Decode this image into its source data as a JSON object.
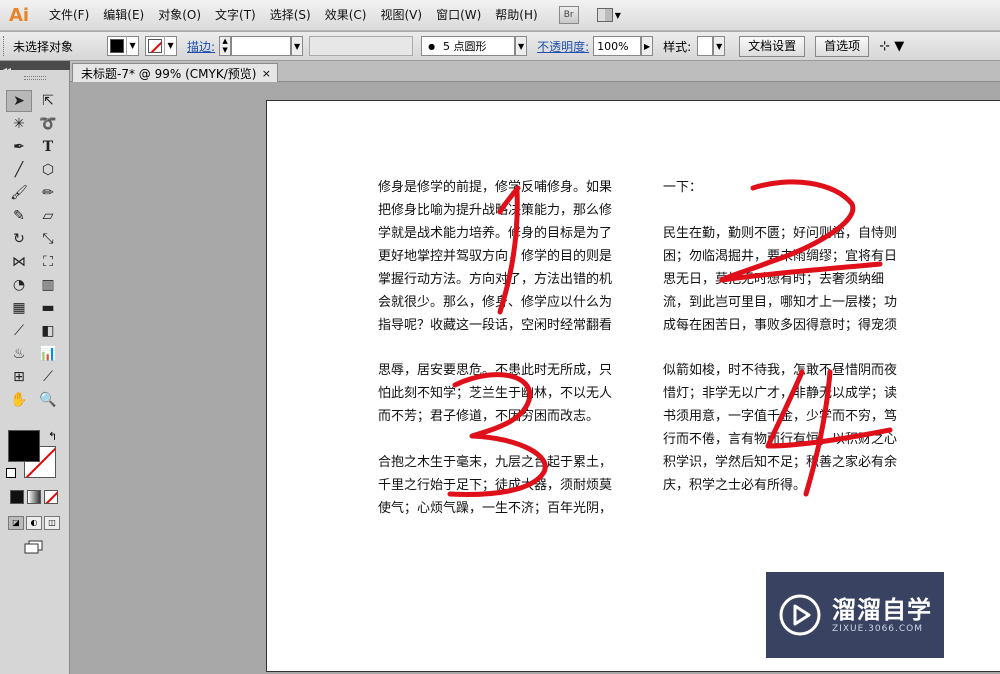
{
  "app": {
    "logo": "Ai",
    "menus": [
      "文件(F)",
      "编辑(E)",
      "对象(O)",
      "文字(T)",
      "选择(S)",
      "效果(C)",
      "视图(V)",
      "窗口(W)",
      "帮助(H)"
    ],
    "bridge_label": "Br"
  },
  "control_bar": {
    "selection_status": "未选择对象",
    "stroke_label": "描边:",
    "brush_value": "5 点圆形",
    "opacity_label": "不透明度:",
    "opacity_value": "100%",
    "style_label": "样式:",
    "doc_setup_button": "文档设置",
    "preferences_button": "首选项"
  },
  "document": {
    "tab_title": "未标题-7* @ 99% (CMYK/预览)",
    "close_glyph": "×"
  },
  "columns": {
    "col1": "修身是修学的前提，修学反哺修身。如果\n把修身比喻为提升战略决策能力，那么修\n学就是战术能力培养。修身的目标是为了\n更好地掌控并驾驭方向，修学的目的则是\n掌握行动方法。方向对了，方法出错的机\n会就很少。那么，修身、修学应以什么为\n指导呢？收藏这一段话，空闲时经常翻看",
    "col2": "一下：\n\n民生在勤，勤则不匮；好问则裕，自恃则\n困；勿临渴掘井，要未雨绸缪；宜将有日\n思无日，莫把无时想有时；去奢须纳细\n流，到此岂可里目，哪知才上一层楼；功\n成每在困苦日，事败多因得意时；得宠须",
    "col3": "思辱，居安要思危。不患此时无所成，只\n怕此刻不知学；芝兰生于幽林，不以无人\n而不芳；君子修道，不因穷困而改志。\n\n合抱之木生于毫末，九层之台起于累土，\n千里之行始于足下；徒成大器，须耐烦莫\n使气；心烦气躁，一生不济；百年光阴，",
    "col4": "似箭如梭，时不待我，怎敢不昼惜阴而夜\n惜灯；非学无以广才，非静无以成学；读\n书须用意，一字值千金，少学而不穷，笃\n行而不倦，言有物而行有恒；以积财之心\n积学识，学然后知不足；积善之家必有余\n庆，积学之士必有所得。"
  },
  "annotations": {
    "color": "#e0101a",
    "numbers": [
      "1",
      "2",
      "3",
      "4"
    ]
  },
  "watermark": {
    "title": "溜溜自学",
    "url": "ZIXUE.3066.COM"
  }
}
